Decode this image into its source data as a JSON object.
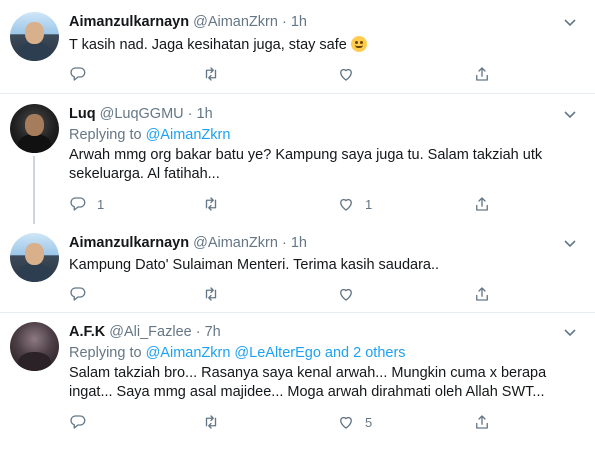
{
  "colors": {
    "accent": "#1da1f2",
    "muted": "#657786",
    "text": "#14171a",
    "divider": "#e6ecf0",
    "thread_line": "#ccd6dd"
  },
  "tweets": [
    {
      "name": "Aimanzulkarnayn",
      "handle": "@AimanZkrn",
      "sep": "·",
      "time": "1h",
      "reply_prefix": "",
      "reply_targets": "",
      "text": "T kasih nad. Jaga kesihatan juga, stay safe",
      "emoji": "smiling-face",
      "counts": {
        "reply": "",
        "retweet": "",
        "like": ""
      }
    },
    {
      "name": "Luq",
      "handle": "@LuqGGMU",
      "sep": "·",
      "time": "1h",
      "reply_prefix": "Replying to",
      "reply_targets": "@AimanZkrn",
      "text": "Arwah mmg org bakar batu ye? Kampung saya juga tu. Salam takziah utk sekeluarga. Al fatihah...",
      "counts": {
        "reply": "1",
        "retweet": "",
        "like": "1"
      }
    },
    {
      "name": "Aimanzulkarnayn",
      "handle": "@AimanZkrn",
      "sep": "·",
      "time": "1h",
      "reply_prefix": "",
      "reply_targets": "",
      "text": "Kampung Dato' Sulaiman Menteri. Terima kasih saudara..",
      "counts": {
        "reply": "",
        "retweet": "",
        "like": ""
      }
    },
    {
      "name": "A.F.K",
      "handle": "@Ali_Fazlee",
      "sep": "·",
      "time": "7h",
      "reply_prefix": "Replying to",
      "reply_targets": "@AimanZkrn @LeAlterEgo and 2 others",
      "text": "Salam takziah bro... Rasanya saya kenal arwah... Mungkin cuma x berapa ingat... Saya mmg asal majidee... Moga arwah dirahmati oleh Allah SWT...",
      "counts": {
        "reply": "",
        "retweet": "",
        "like": "5"
      }
    }
  ],
  "icons": {
    "reply": "reply-icon",
    "retweet": "retweet-icon",
    "like": "like-icon",
    "share": "share-icon",
    "more": "chevron-down-icon"
  }
}
